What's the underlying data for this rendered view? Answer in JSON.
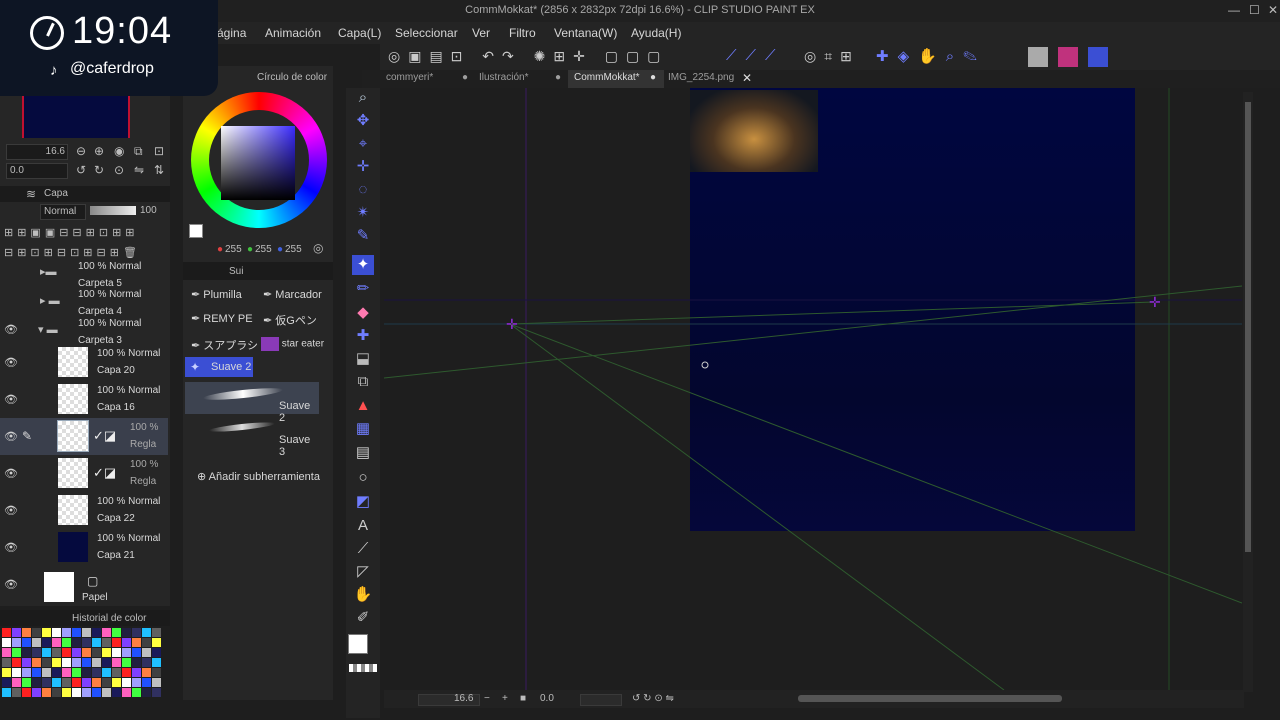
{
  "window": {
    "title": "CommMokkat* (2856 x 2832px 72dpi 16.6%) - CLIP STUDIO PAINT EX",
    "min": "—",
    "max": "☐",
    "close": "✕"
  },
  "menu": [
    "ágina",
    "Animación",
    "Capa(L)",
    "Seleccionar",
    "Ver",
    "Filtro",
    "Ventana(W)",
    "Ayuda(H)"
  ],
  "clock": {
    "time": "19:04",
    "handle": "@caferdrop",
    "tiktok": "♪"
  },
  "navigator": {
    "zoom": "16.6",
    "rotate": "0.0"
  },
  "layer_panel": {
    "tab": "Capa",
    "blend": "Normal",
    "opacity": "100",
    "layers": [
      {
        "meta": "100 % Normal",
        "name": "Carpeta 5"
      },
      {
        "meta": "100 % Normal",
        "name": "Carpeta 4"
      },
      {
        "meta": "100 % Normal",
        "name": "Carpeta 3"
      },
      {
        "meta": "100 % Normal",
        "name": "Capa 20"
      },
      {
        "meta": "100 % Normal",
        "name": "Capa 16"
      },
      {
        "meta": "100 %",
        "name": "Regla"
      },
      {
        "meta": "100 %",
        "name": "Regla"
      },
      {
        "meta": "100 % Normal",
        "name": "Capa 22"
      },
      {
        "meta": "100 % Normal",
        "name": "Capa 21"
      },
      {
        "meta": "",
        "name": "Papel"
      }
    ]
  },
  "color_history": {
    "title": "Historial de color"
  },
  "color_wheel": {
    "title": "Círculo de color",
    "r": "255",
    "g": "255",
    "b": "255"
  },
  "subtool": {
    "tab": "Sui",
    "items": [
      {
        "label": "Plumilla"
      },
      {
        "label": "Marcador"
      },
      {
        "label": "REMY PE"
      },
      {
        "label": "仮Gペン"
      },
      {
        "label": "スアプラシ"
      },
      {
        "label": "star eater"
      },
      {
        "label": "Suave 2"
      }
    ],
    "brushes": [
      "Suave 2",
      "Suave 3"
    ],
    "add": "Añadir subherramienta"
  },
  "tabs": [
    {
      "label": "commyeri*"
    },
    {
      "label": "Ilustración*"
    },
    {
      "label": "CommMokkat*"
    },
    {
      "label": "IMG_2254.png"
    }
  ],
  "statusbar": {
    "zoom": "16.6",
    "angle": "0.0"
  },
  "colors": {
    "canvas": "#04083a",
    "bg": "#1e1e1e",
    "accent": "#6f7dff"
  }
}
